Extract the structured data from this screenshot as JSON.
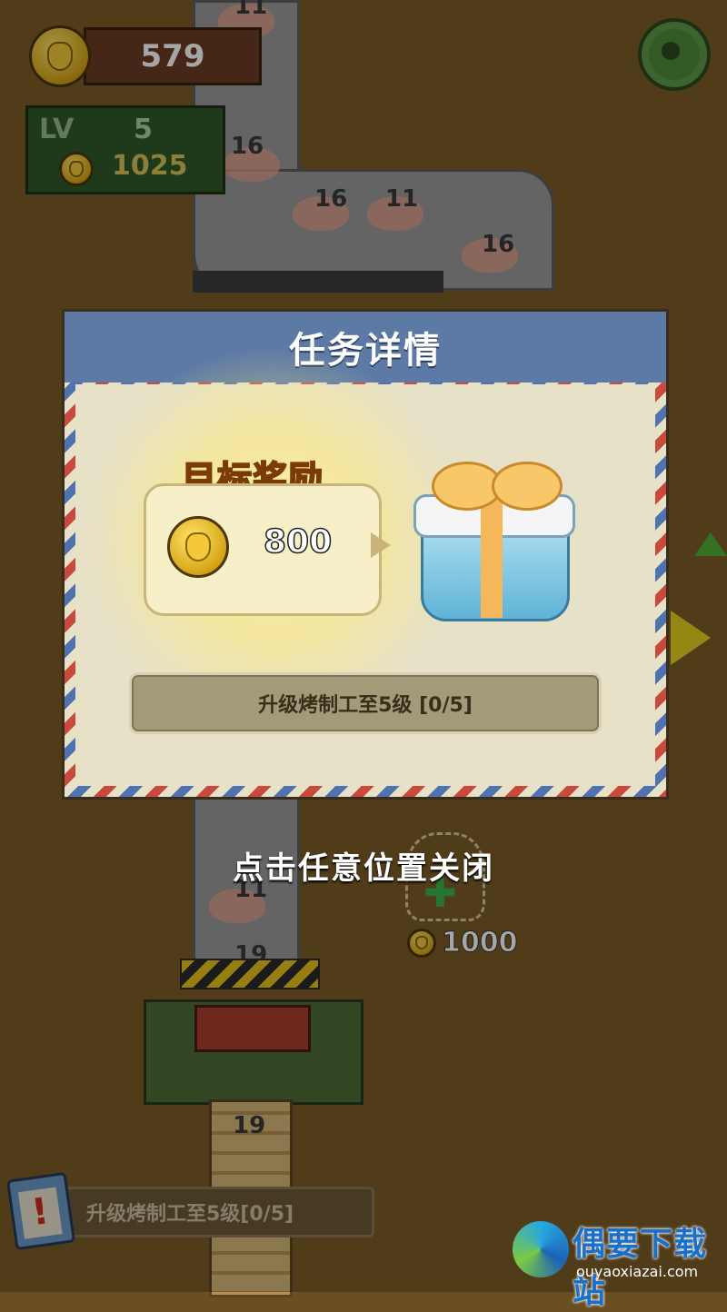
{
  "hud": {
    "coins": "579",
    "level_label": "LV",
    "level": "5",
    "upgrade_cost": "1025"
  },
  "scene": {
    "belt_numbers": [
      "11",
      "16",
      "16",
      "11",
      "16",
      "11",
      "19",
      "19"
    ],
    "add_station_cost": "1000"
  },
  "modal": {
    "title": "任务详情",
    "reward_title": "目标奖励",
    "reward_amount": "800",
    "task_text": "升级烤制工至5级 [0/5]"
  },
  "close_hint": "点击任意位置关闭",
  "bottom_task": {
    "text": "升级烤制工至5级[0/5]"
  },
  "watermark": {
    "name": "偶要下载站",
    "url": "ouyaoxiazai.com"
  },
  "icons": {
    "settings": "gear-icon",
    "coin": "bunny-coin-icon",
    "gift": "gift-box-icon",
    "alert": "clipboard-alert-icon",
    "add": "plus-icon",
    "next": "play-arrow-icon"
  },
  "colors": {
    "modal_header": "#5d7aa6",
    "reward_title": "#f7a21b",
    "coin_bar": "#6a3d24",
    "level_box": "#2e5a2a"
  }
}
